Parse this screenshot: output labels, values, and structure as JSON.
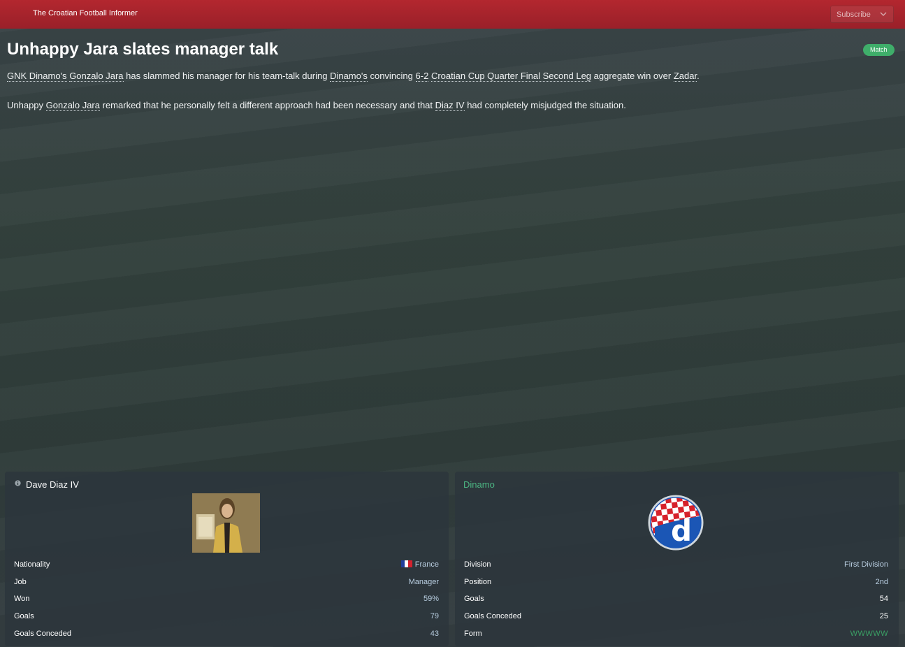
{
  "header": {
    "publication": "The Croatian Football Informer",
    "subscribe_label": "Subscribe",
    "accent_color": "#a8232c"
  },
  "article": {
    "title": "Unhappy Jara slates manager talk",
    "tag": "Match",
    "tag_color": "#3fae6a",
    "paragraph1": {
      "club": "GNK Dinamo's",
      "player": "Gonzalo Jara",
      "text1": "has slammed his manager for his team-talk during",
      "club2": "Dinamo's",
      "text2": "convincing",
      "score": "6-2",
      "competition": "Croatian Cup Quarter Final Second Leg",
      "text3": "aggregate win over",
      "opponent": "Zadar",
      "end": "."
    },
    "paragraph2": {
      "start": "Unhappy",
      "player": "Gonzalo Jara",
      "text1": "remarked that he personally felt a different approach had been necessary and that",
      "manager": "Diaz IV",
      "text2": "had completely misjudged the situation."
    }
  },
  "manager_panel": {
    "name": "Dave Diaz IV",
    "rows": [
      {
        "label": "Nationality",
        "value": "France"
      },
      {
        "label": "Job",
        "value": "Manager"
      },
      {
        "label": "Won",
        "value": "59%"
      },
      {
        "label": "Goals",
        "value": "79"
      },
      {
        "label": "Goals Conceded",
        "value": "43"
      }
    ]
  },
  "club_panel": {
    "name": "Dinamo",
    "name_color": "#4cb683",
    "crest_letter": "d",
    "rows": [
      {
        "label": "Division",
        "value": "First Division"
      },
      {
        "label": "Position",
        "value": "2nd"
      },
      {
        "label": "Goals",
        "value": "54"
      },
      {
        "label": "Goals Conceded",
        "value": "25"
      },
      {
        "label": "Form",
        "value": "WWWWW"
      }
    ],
    "form_color": "#3aa064"
  }
}
